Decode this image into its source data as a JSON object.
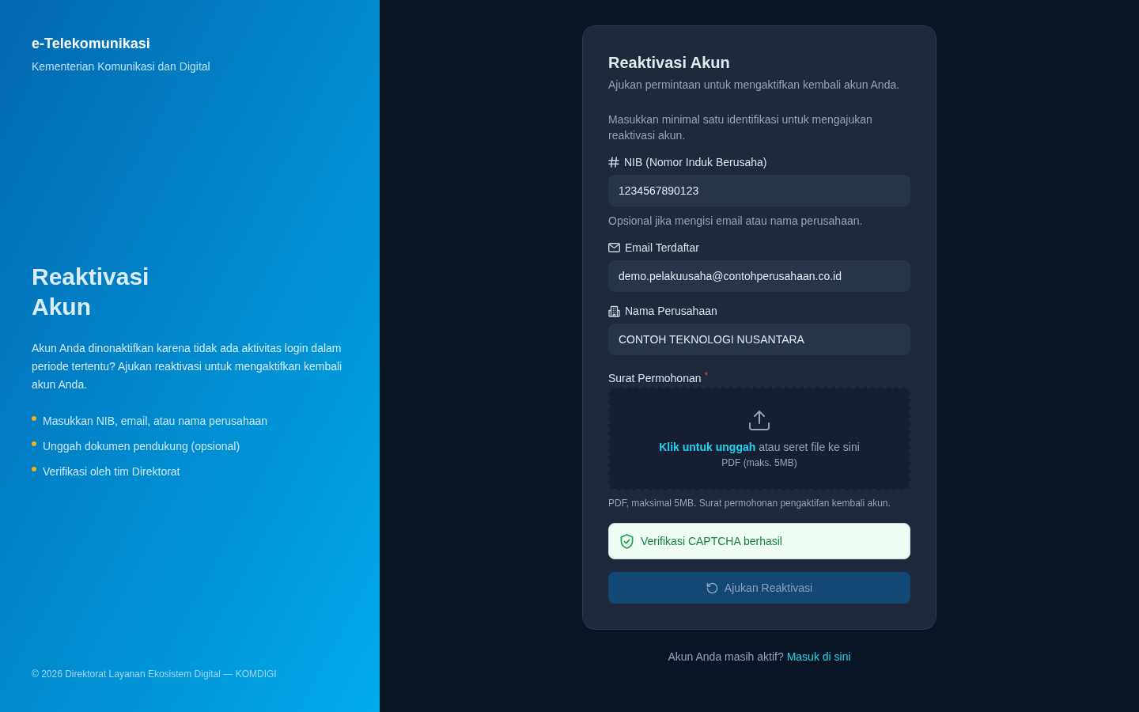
{
  "sidebar": {
    "brand_title": "e-Telekomunikasi",
    "brand_subtitle": "Kementerian Komunikasi dan Digital",
    "heading": "Reaktivasi Akun",
    "description": "Akun Anda dinonaktifkan karena tidak ada aktivitas login dalam periode tertentu? Ajukan reaktivasi untuk mengaktifkan kembali akun Anda.",
    "steps": [
      "Masukkan NIB, email, atau nama perusahaan",
      "Unggah dokumen pendukung (opsional)",
      "Verifikasi oleh tim Direktorat"
    ],
    "footer": "© 2026 Direktorat Layanan Ekosistem Digital — KOMDIGI"
  },
  "form": {
    "title": "Reaktivasi Akun",
    "subtitle": "Ajukan permintaan untuk mengaktifkan kembali akun Anda.",
    "instruction": "Masukkan minimal satu identifikasi untuk mengajukan reaktivasi akun.",
    "nib_field": {
      "label": "NIB (Nomor Induk Berusaha)",
      "value": "1234567890123",
      "hint": "Opsional jika mengisi email atau nama perusahaan."
    },
    "email_field": {
      "label": "Email Terdaftar",
      "value": "demo.pelakuusaha@contohperusahaan.co.id"
    },
    "company_field": {
      "label": "Nama Perusahaan",
      "value": "CONTOH TEKNOLOGI NUSANTARA"
    },
    "letter_upload": {
      "label": "Surat Permohonan",
      "required_mark": "*",
      "link": "Klik untuk unggah",
      "prompt": "atau seret file ke sini",
      "formats": "PDF (maks. 5MB)",
      "hint": "PDF, maksimal 5MB. Surat permohonan pengaktifan kembali akun."
    },
    "captcha": {
      "verified": true,
      "message": "Verifikasi CAPTCHA berhasil"
    },
    "submit_button": {
      "label": "Ajukan Reaktivasi",
      "disabled": true
    }
  },
  "login_prompt": {
    "text": "Akun Anda masih aktif?",
    "link": "Masuk di sini"
  }
}
